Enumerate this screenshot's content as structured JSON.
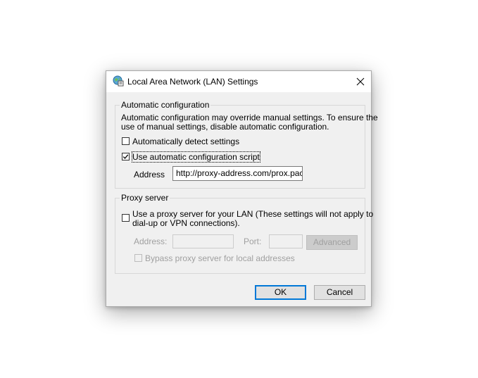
{
  "dialog": {
    "title": "Local Area Network (LAN) Settings",
    "title_icon": "globe-settings-icon",
    "close_label": "close"
  },
  "auto_config": {
    "group_label": "Automatic configuration",
    "description_line1": "Automatic configuration may override manual settings.  To ensure the",
    "description_line2": "use of manual settings, disable automatic configuration.",
    "detect_label": "Automatically detect settings",
    "detect_checked": false,
    "script_label": "Use automatic configuration script",
    "script_checked": true,
    "address_label": "Address",
    "address_value": "http://proxy-address.com/prox.pac"
  },
  "proxy": {
    "group_label": "Proxy server",
    "use_proxy_line1": "Use a proxy server for your LAN (These settings will not apply to",
    "use_proxy_line2": "dial-up or VPN connections).",
    "use_proxy_checked": false,
    "address_label": "Address:",
    "address_value": "",
    "port_label": "Port:",
    "port_value": "",
    "advanced_label": "Advanced",
    "bypass_label": "Bypass proxy server for local addresses",
    "bypass_checked": false
  },
  "buttons": {
    "ok_label": "OK",
    "cancel_label": "Cancel"
  }
}
